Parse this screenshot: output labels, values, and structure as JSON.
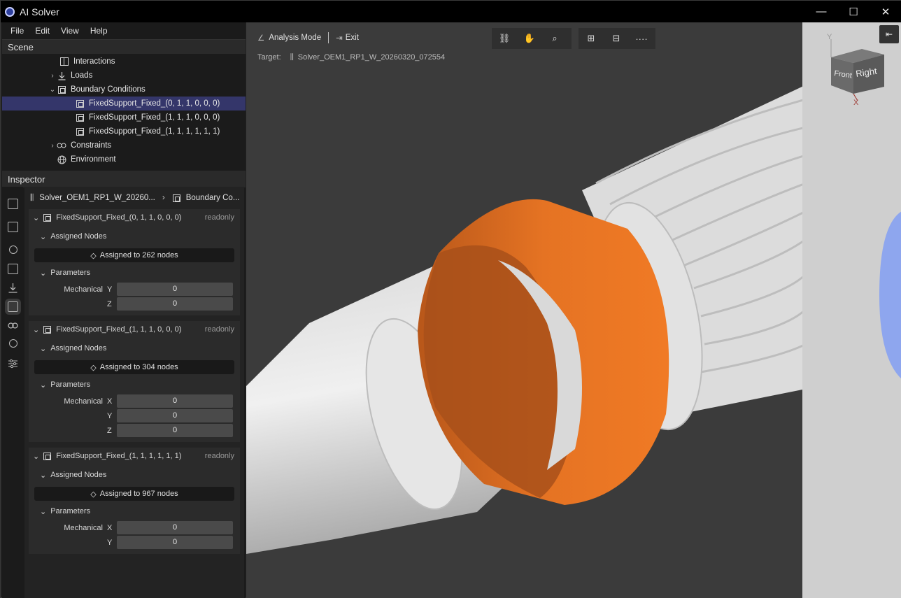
{
  "app": {
    "title": "AI Solver"
  },
  "window_controls": {
    "minimize": "—",
    "maximize": "☐",
    "close": "✕"
  },
  "menu": [
    "File",
    "Edit",
    "View",
    "Help"
  ],
  "scene": {
    "title": "Scene",
    "items": [
      {
        "label": "Interactions",
        "icon": "split-icon"
      },
      {
        "label": "Loads",
        "icon": "download-icon"
      },
      {
        "label": "Boundary Conditions",
        "icon": "box-icon"
      },
      {
        "label": "FixedSupport_Fixed_(0, 1, 1, 0, 0, 0)",
        "icon": "box-icon",
        "selected": true
      },
      {
        "label": "FixedSupport_Fixed_(1, 1, 1, 0, 0, 0)",
        "icon": "box-icon"
      },
      {
        "label": "FixedSupport_Fixed_(1, 1, 1, 1, 1, 1)",
        "icon": "box-icon"
      },
      {
        "label": "Constraints",
        "icon": "link-icon"
      },
      {
        "label": "Environment",
        "icon": "globe-icon"
      }
    ]
  },
  "inspector": {
    "title": "Inspector",
    "breadcrumb": {
      "solver": "Solver_OEM1_RP1_W_20260...",
      "section": "Boundary Co..."
    },
    "cards": [
      {
        "title": "FixedSupport_Fixed_(0, 1, 1, 0, 0, 0)",
        "status": "readonly",
        "assigned_label": "Assigned Nodes",
        "assigned": "Assigned to 262 nodes",
        "params_label": "Parameters",
        "group": "Mechanical",
        "params": [
          {
            "axis": "Y",
            "value": "0"
          },
          {
            "axis": "Z",
            "value": "0"
          }
        ]
      },
      {
        "title": "FixedSupport_Fixed_(1, 1, 1, 0, 0, 0)",
        "status": "readonly",
        "assigned_label": "Assigned Nodes",
        "assigned": "Assigned to 304 nodes",
        "params_label": "Parameters",
        "group": "Mechanical",
        "params": [
          {
            "axis": "X",
            "value": "0"
          },
          {
            "axis": "Y",
            "value": "0"
          },
          {
            "axis": "Z",
            "value": "0"
          }
        ]
      },
      {
        "title": "FixedSupport_Fixed_(1, 1, 1, 1, 1, 1)",
        "status": "readonly",
        "assigned_label": "Assigned Nodes",
        "assigned": "Assigned to 967 nodes",
        "params_label": "Parameters",
        "group": "Mechanical",
        "params": [
          {
            "axis": "X",
            "value": "0"
          },
          {
            "axis": "Y",
            "value": "0"
          }
        ]
      }
    ]
  },
  "viewport": {
    "mode_label": "Analysis Mode",
    "exit_label": "Exit",
    "target_label": "Target:",
    "target_name": "Solver_OEM1_RP1_W_20260320_072554",
    "more_label": "····",
    "nav_cube": {
      "front": "Front",
      "right": "Right",
      "axis_y": "Y",
      "axis_x": "X"
    },
    "colors": {
      "highlight": "#f07a25",
      "selection_blue": "#7f9df0"
    }
  }
}
